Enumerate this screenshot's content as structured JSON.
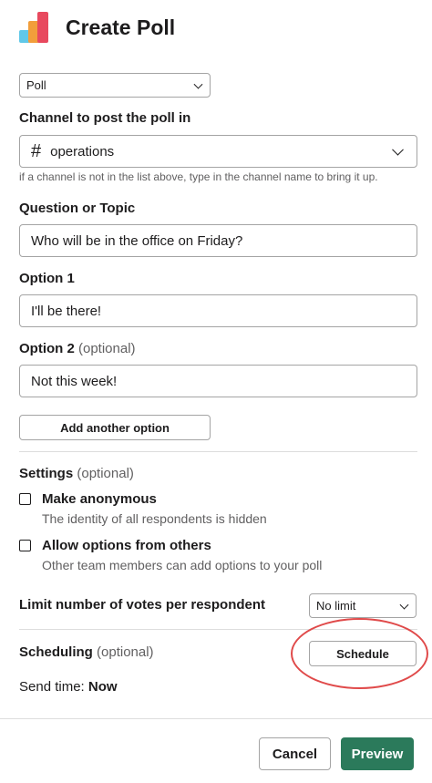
{
  "header": {
    "title": "Create Poll",
    "logo_icon": "poll-bars-icon"
  },
  "poll_type": {
    "value": "Poll"
  },
  "channel": {
    "label": "Channel to post the poll in",
    "hash": "#",
    "value": "operations",
    "help": "if a channel is not in the list above, type in the channel name to bring it up."
  },
  "question": {
    "label": "Question or Topic",
    "value": "Who will be in the office on Friday?"
  },
  "option1": {
    "label": "Option 1",
    "value": "I'll be there!"
  },
  "option2": {
    "label": "Option 2",
    "optional": "(optional)",
    "value": "Not this week!"
  },
  "add_option": {
    "label": "Add another option"
  },
  "settings": {
    "label": "Settings",
    "optional": "(optional)",
    "anonymous": {
      "title": "Make anonymous",
      "desc": "The identity of all respondents is hidden",
      "checked": false
    },
    "allow_others": {
      "title": "Allow options from others",
      "desc": "Other team members can add options to your poll",
      "checked": false
    }
  },
  "limit": {
    "label": "Limit number of votes per respondent",
    "value": "No limit"
  },
  "scheduling": {
    "label": "Scheduling",
    "optional": "(optional)",
    "button": "Schedule"
  },
  "send_time": {
    "label": "Send time:",
    "value": "Now"
  },
  "footer": {
    "cancel": "Cancel",
    "preview": "Preview"
  },
  "colors": {
    "primary": "#2b7a5b",
    "highlight": "#e04a4a"
  }
}
